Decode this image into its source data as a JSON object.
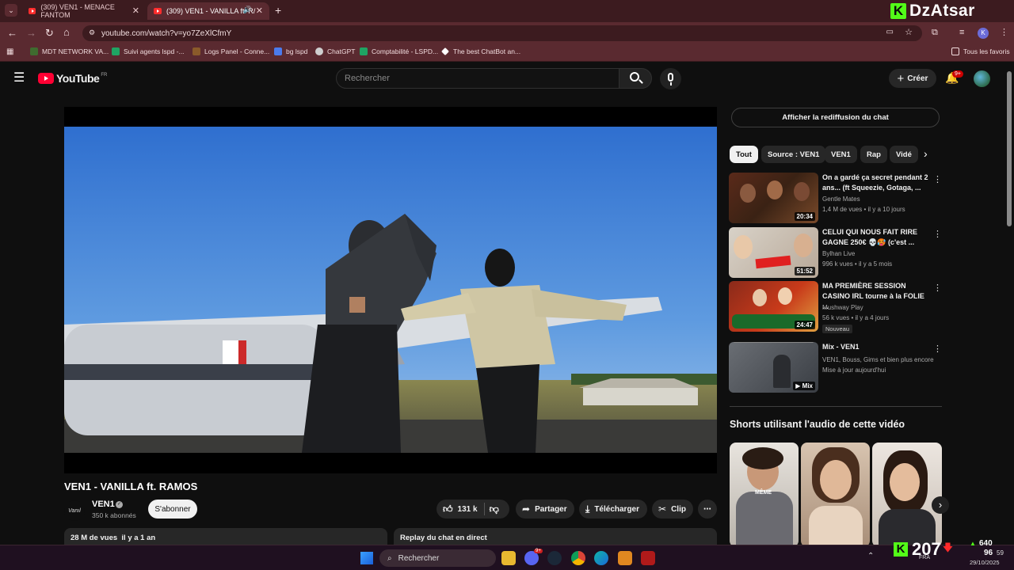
{
  "browser": {
    "tabs": [
      {
        "title": "(309) VEN1 - MENACE FANTOM",
        "active": false
      },
      {
        "title": "(309) VEN1 - VANILLA ft. R/",
        "active": true
      }
    ],
    "new_tab": "+",
    "url": "youtube.com/watch?v=yo7ZeXlCfmY",
    "bookmarks": [
      "MDT NETWORK VA...",
      "Suivi agents lspd -...",
      "Logs Panel - Conne...",
      "bg lspd",
      "ChatGPT",
      "Comptabilité - LSPD...",
      "The best ChatBot an..."
    ],
    "all_favorites": "Tous les favoris"
  },
  "overlay": {
    "brand": "DzAtsar",
    "brand_letter": "K",
    "viewers": "207",
    "stat_up": "640",
    "stat_down": "96"
  },
  "youtube": {
    "logo": "YouTube",
    "region": "FR",
    "search_placeholder": "Rechercher",
    "create_label": "Créer",
    "notif_badge": "9+"
  },
  "video": {
    "title": "VEN1 - VANILLA ft. RAMOS",
    "channel": "VEN1",
    "subscribers": "350 k abonnés",
    "subscribe_label": "S'abonner",
    "likes": "131 k",
    "share_label": "Partager",
    "download_label": "Télécharger",
    "clip_label": "Clip",
    "views_line": "28 M de vues  il y a 1 an",
    "replay_chat": "Replay du chat en direct",
    "channel_logo_text": "Vanıl"
  },
  "sidebar": {
    "chat_button": "Afficher la rediffusion du chat",
    "chips": [
      "Tout",
      "Source : VEN1",
      "VEN1",
      "Rap",
      "Vidé"
    ],
    "recommendations": [
      {
        "title": "On a gardé ça secret pendant 2 ans... (ft Squeezie, Gotaga, ...",
        "channel": "Gentle Mates",
        "meta": "1,4 M de vues • il y a 10 jours",
        "duration": "20:34",
        "badge": ""
      },
      {
        "title": "CELUI QUI NOUS FAIT RIRE GAGNE 250€ 💀🥵 (c'est ...",
        "channel": "Bylhan Live",
        "meta": "996 k vues • il y a 5 mois",
        "duration": "51:52",
        "badge": ""
      },
      {
        "title": "MA PREMIÈRE SESSION CASINO IRL tourne à la FOLIE ...",
        "channel": "Mushway Play",
        "meta": "56 k vues • il y a 4 jours",
        "duration": "24:47",
        "badge": "Nouveau"
      },
      {
        "title": "Mix - VEN1",
        "channel": "VEN1, Bouss, Gims et bien plus encore",
        "meta": "Mise à jour aujourd'hui",
        "duration": "Mix",
        "badge": ""
      }
    ],
    "shorts_heading": "Shorts utilisant l'audio de cette vidéo",
    "short_text": "MÊME"
  },
  "taskbar": {
    "search": "Rechercher",
    "lang": "FRA",
    "time": "59",
    "date": "29/10/2025",
    "badge": "9+"
  },
  "colors": {
    "browser_dark": "#3c1b1f",
    "browser_light": "#5a2a30",
    "yt_red": "#ff0033",
    "brand_green": "#53fc18"
  }
}
